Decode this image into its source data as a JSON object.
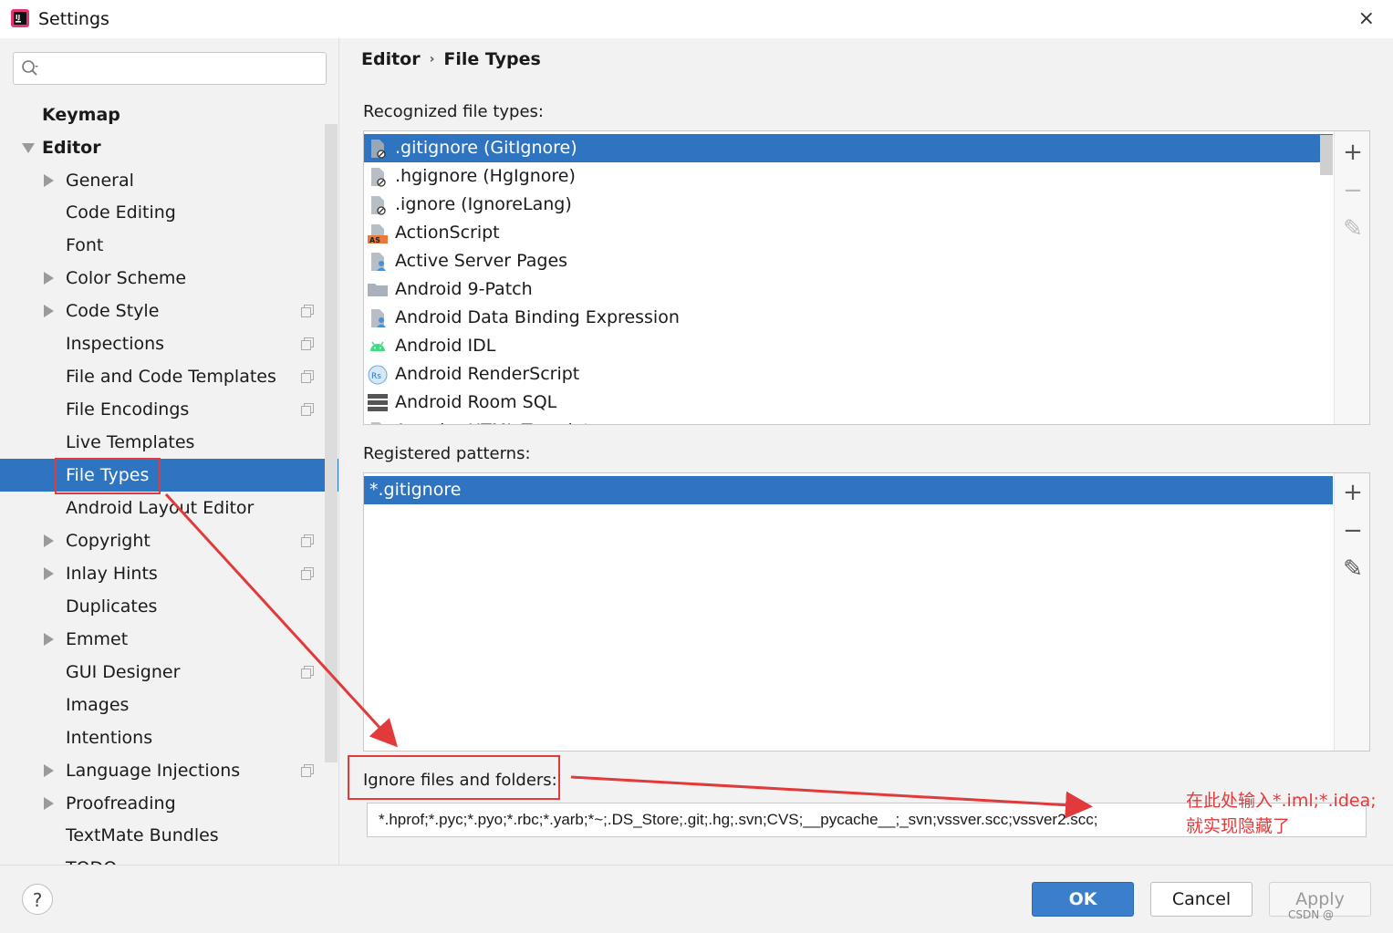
{
  "window": {
    "title": "Settings",
    "close_glyph": "×"
  },
  "search": {
    "placeholder": ""
  },
  "sidebar": {
    "items": [
      {
        "label": "Keymap"
      },
      {
        "label": "Editor"
      },
      {
        "label": "General"
      },
      {
        "label": "Code Editing"
      },
      {
        "label": "Font"
      },
      {
        "label": "Color Scheme"
      },
      {
        "label": "Code Style"
      },
      {
        "label": "Inspections"
      },
      {
        "label": "File and Code Templates"
      },
      {
        "label": "File Encodings"
      },
      {
        "label": "Live Templates"
      },
      {
        "label": "File Types"
      },
      {
        "label": "Android Layout Editor"
      },
      {
        "label": "Copyright"
      },
      {
        "label": "Inlay Hints"
      },
      {
        "label": "Duplicates"
      },
      {
        "label": "Emmet"
      },
      {
        "label": "GUI Designer"
      },
      {
        "label": "Images"
      },
      {
        "label": "Intentions"
      },
      {
        "label": "Language Injections"
      },
      {
        "label": "Proofreading"
      },
      {
        "label": "TextMate Bundles"
      },
      {
        "label": "TODO"
      }
    ]
  },
  "breadcrumb": {
    "parent": "Editor",
    "separator": "›",
    "current": "File Types"
  },
  "recognized": {
    "label": "Recognized file types:",
    "items": [
      {
        "label": ".gitignore (GitIgnore)",
        "icon": "ignore-file-icon"
      },
      {
        "label": ".hgignore (HgIgnore)",
        "icon": "ignore-file-icon"
      },
      {
        "label": ".ignore (IgnoreLang)",
        "icon": "ignore-file-icon"
      },
      {
        "label": "ActionScript",
        "icon": "actionscript-icon"
      },
      {
        "label": "Active Server Pages",
        "icon": "asp-file-icon"
      },
      {
        "label": "Android 9-Patch",
        "icon": "folder-icon"
      },
      {
        "label": "Android Data Binding Expression",
        "icon": "binding-file-icon"
      },
      {
        "label": "Android IDL",
        "icon": "android-icon"
      },
      {
        "label": "Android RenderScript",
        "icon": "renderscript-icon"
      },
      {
        "label": "Android Room SQL",
        "icon": "database-icon"
      },
      {
        "label": "Angular HTML Template",
        "icon": "html-file-icon"
      }
    ]
  },
  "patterns": {
    "label": "Registered patterns:",
    "items": [
      {
        "label": "*.gitignore"
      }
    ]
  },
  "tools": {
    "add": "+",
    "remove": "−",
    "edit": "✎"
  },
  "ignore": {
    "label": "Ignore files and folders:",
    "value": "*.hprof;*.pyc;*.pyo;*.rbc;*.yarb;*~;.DS_Store;.git;.hg;.svn;CVS;__pycache__;_svn;vssver.scc;vssver2.scc;"
  },
  "annotation": {
    "line1": "在此处输入*.iml;*.idea;",
    "line2": "就实现隐藏了"
  },
  "footer": {
    "help": "?",
    "ok": "OK",
    "cancel": "Cancel",
    "apply": "Apply"
  },
  "watermark": "CSDN @"
}
